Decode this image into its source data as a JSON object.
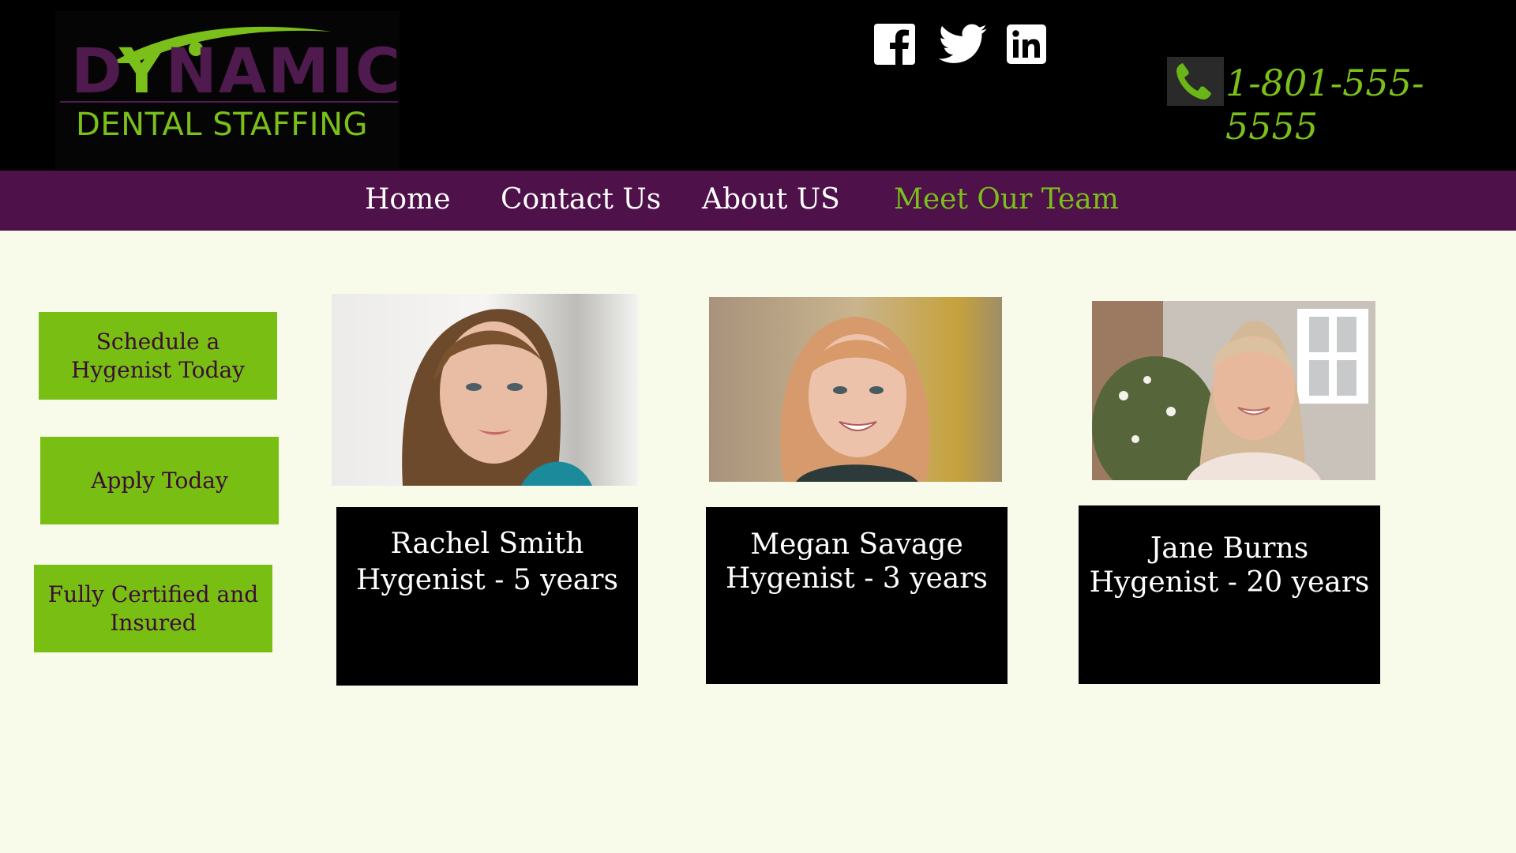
{
  "logo": {
    "line1_pre": "D",
    "line1_y": "Y",
    "line1_post": "NAMIC",
    "line2": "DENTAL STAFFING"
  },
  "social": [
    {
      "icon": "facebook-icon",
      "label": "Facebook"
    },
    {
      "icon": "twitter-icon",
      "label": "Twitter"
    },
    {
      "icon": "linkedin-icon",
      "label": "LinkedIn"
    }
  ],
  "contact": {
    "icon": "phone-icon",
    "phone": "1-801-555-5555"
  },
  "nav": {
    "items": [
      {
        "label": "Home"
      },
      {
        "label": "Contact Us"
      },
      {
        "label": "About US"
      },
      {
        "label": "Meet Our Team",
        "active": true
      }
    ]
  },
  "sidebar": {
    "buttons": [
      {
        "line1": "Schedule a",
        "line2": "Hygenist Today"
      },
      {
        "line1": "Apply Today",
        "line2": ""
      },
      {
        "line1": "Fully Certified and",
        "line2": "Insured"
      }
    ]
  },
  "team": [
    {
      "name": "Rachel Smith",
      "role": "Hygenist - 5 years"
    },
    {
      "name": "Megan Savage",
      "role": "Hygenist - 3 years"
    },
    {
      "name": "Jane Burns",
      "role": "Hygenist - 20 years"
    }
  ],
  "colors": {
    "header_bg": "#000000",
    "nav_bg": "#4e1149",
    "accent_green": "#7bbf1b",
    "page_bg": "#f8fbea",
    "brand_purple": "#4f1a4d"
  }
}
